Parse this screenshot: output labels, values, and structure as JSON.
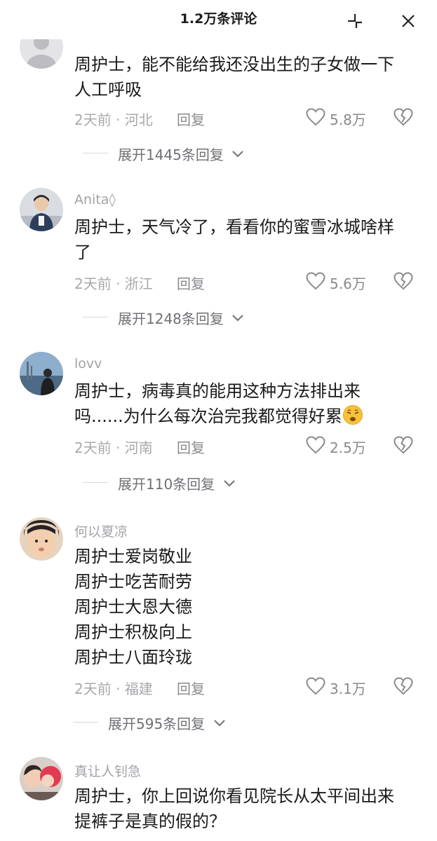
{
  "header": {
    "title": "1.2万条评论",
    "collapse_icon": "collapse-icon",
    "close_icon": "close-icon"
  },
  "comments": [
    {
      "username": "",
      "text_lines": [
        "周护士，能不能给我还没出生的子女做一下",
        "人工呼吸"
      ],
      "time_location": "2天前 · 河北",
      "reply_label": "回复",
      "likes": "5.8万",
      "expand_label": "展开1445条回复"
    },
    {
      "username": "Anita◊",
      "text_lines": [
        "周护士，天气冷了，看看你的蜜雪冰城啥样",
        "了"
      ],
      "time_location": "2天前 · 浙江",
      "reply_label": "回复",
      "likes": "5.6万",
      "expand_label": "展开1248条回复"
    },
    {
      "username": "lovv",
      "text_lines": [
        "周护士，病毒真的能用这种方法排出来",
        "吗......为什么每次治完我都觉得好累"
      ],
      "emoji": "tired-face-emoji",
      "time_location": "2天前 · 河南",
      "reply_label": "回复",
      "likes": "2.5万",
      "expand_label": "展开110条回复"
    },
    {
      "username": "何以夏凉",
      "text_lines": [
        "周护士爱岗敬业",
        "周护士吃苦耐劳",
        "周护士大恩大德",
        "周护士积极向上",
        "周护士八面玲珑"
      ],
      "time_location": "2天前 · 福建",
      "reply_label": "回复",
      "likes": "3.1万",
      "expand_label": "展开595条回复"
    },
    {
      "username": "真让人钊急",
      "text_lines": [
        "周护士，你上回说你看见院长从太平间出来",
        "提裤子是真的假的？"
      ]
    }
  ],
  "colors": {
    "text": "#1a1a1a",
    "muted": "#a8a8ad",
    "icon": "#8a8a8f"
  }
}
